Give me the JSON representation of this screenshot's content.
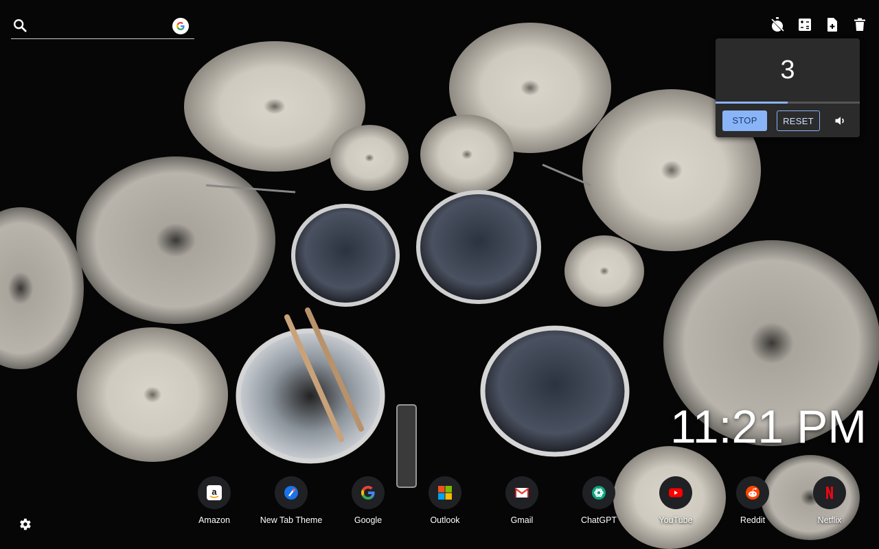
{
  "search": {
    "placeholder": "",
    "value": ""
  },
  "toolbar": {
    "icons": [
      "timer-off-icon",
      "calculator-icon",
      "note-add-icon",
      "trash-icon"
    ]
  },
  "timer": {
    "count": "3",
    "progress": 0.5,
    "stop_label": "STOP",
    "reset_label": "RESET",
    "accent": "#8ab4f8"
  },
  "clock": {
    "time": "11:21 PM"
  },
  "shortcuts": [
    {
      "label": "Amazon",
      "icon": "amazon-icon"
    },
    {
      "label": "New Tab Theme",
      "icon": "new-tab-theme-icon"
    },
    {
      "label": "Google",
      "icon": "google-icon"
    },
    {
      "label": "Outlook",
      "icon": "outlook-icon"
    },
    {
      "label": "Gmail",
      "icon": "gmail-icon"
    },
    {
      "label": "ChatGPT",
      "icon": "chatgpt-icon"
    },
    {
      "label": "YouTube",
      "icon": "youtube-icon"
    },
    {
      "label": "Reddit",
      "icon": "reddit-icon"
    },
    {
      "label": "Netflix",
      "icon": "netflix-icon"
    }
  ],
  "colors": {
    "youtube": "#ff0000",
    "netflix": "#e50914",
    "reddit": "#ff4500",
    "tile_bg": "#202124"
  }
}
